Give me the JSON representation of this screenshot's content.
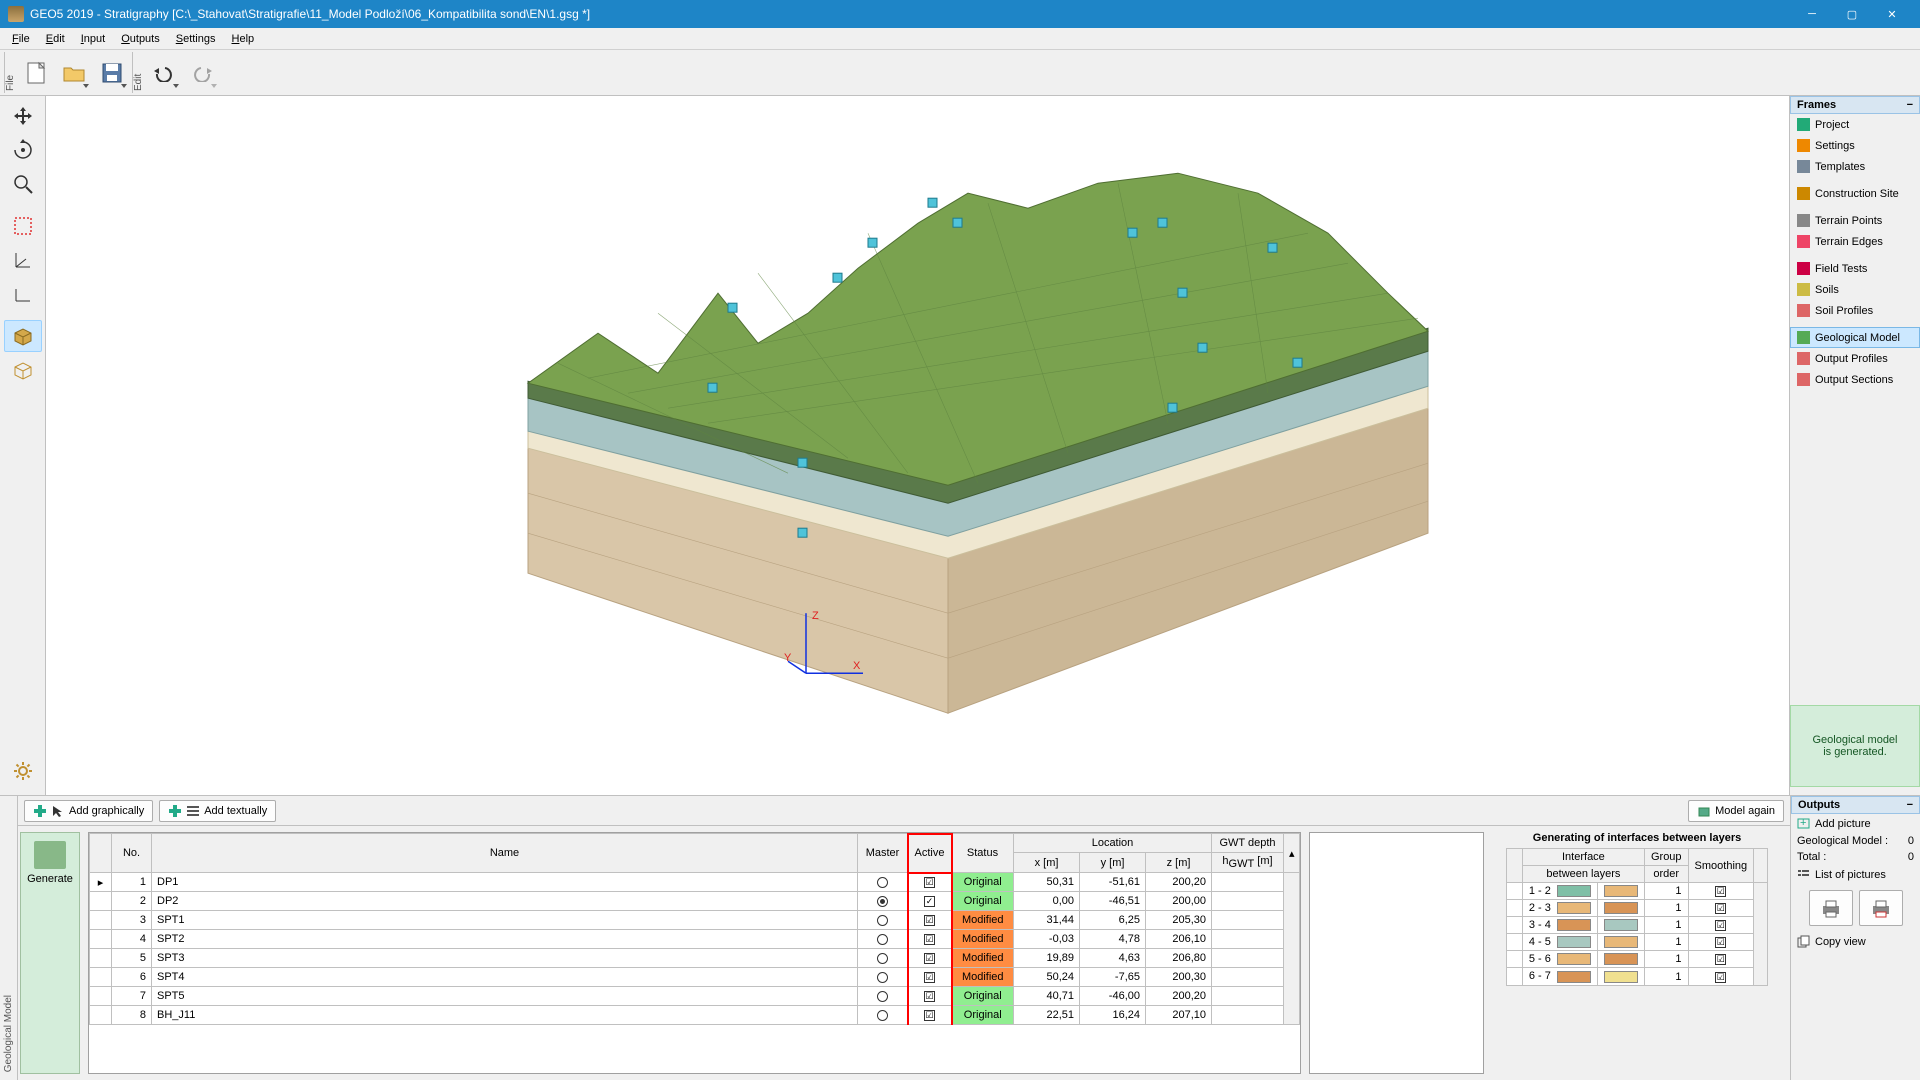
{
  "titlebar": {
    "app": "GEO5 2019 - Stratigraphy [C:\\_Stahovat\\Stratigrafie\\11_Model Podloží\\06_Kompatibilita sond\\EN\\1.gsg *]"
  },
  "menu": {
    "file": "File",
    "edit": "Edit",
    "input": "Input",
    "outputs": "Outputs",
    "settings": "Settings",
    "help": "Help"
  },
  "toolbar_labels": {
    "file": "File",
    "edit": "Edit"
  },
  "frames": {
    "title": "Frames",
    "items": [
      {
        "label": "Project",
        "icon": "#2a7"
      },
      {
        "label": "Settings",
        "icon": "#e80"
      },
      {
        "label": "Templates",
        "icon": "#789"
      },
      {
        "label": "Construction Site",
        "icon": "#c80"
      },
      {
        "label": "Terrain Points",
        "icon": "#888"
      },
      {
        "label": "Terrain Edges",
        "icon": "#e46"
      },
      {
        "label": "Field Tests",
        "icon": "#c04"
      },
      {
        "label": "Soils",
        "icon": "#cb4"
      },
      {
        "label": "Soil Profiles",
        "icon": "#d66"
      },
      {
        "label": "Geological Model",
        "icon": "#5a5",
        "selected": true
      },
      {
        "label": "Output Profiles",
        "icon": "#d66"
      },
      {
        "label": "Output Sections",
        "icon": "#d66"
      }
    ],
    "groups": [
      3,
      1,
      2,
      3,
      3
    ],
    "status": "Geological model\nis generated."
  },
  "bottom": {
    "label": "Geological Model",
    "add_graph": "Add graphically",
    "add_text": "Add textually",
    "model_again": "Model again",
    "generate": "Generate",
    "headers": {
      "no": "No.",
      "name": "Name",
      "master": "Master",
      "active": "Active",
      "status": "Status",
      "location": "Location",
      "x": "x [m]",
      "y": "y [m]",
      "z": "z [m]",
      "gwt": "GWT depth",
      "hgwt": "hGWT [m]"
    },
    "rows": [
      {
        "no": 1,
        "name": "DP1",
        "master": false,
        "active": true,
        "status": "Original",
        "x": "50,31",
        "y": "-51,61",
        "z": "200,20",
        "gwt": ""
      },
      {
        "no": 2,
        "name": "DP2",
        "master": true,
        "active": "tick",
        "status": "Original",
        "x": "0,00",
        "y": "-46,51",
        "z": "200,00",
        "gwt": ""
      },
      {
        "no": 3,
        "name": "SPT1",
        "master": false,
        "active": true,
        "status": "Modified",
        "x": "31,44",
        "y": "6,25",
        "z": "205,30",
        "gwt": ""
      },
      {
        "no": 4,
        "name": "SPT2",
        "master": false,
        "active": true,
        "status": "Modified",
        "x": "-0,03",
        "y": "4,78",
        "z": "206,10",
        "gwt": ""
      },
      {
        "no": 5,
        "name": "SPT3",
        "master": false,
        "active": true,
        "status": "Modified",
        "x": "19,89",
        "y": "4,63",
        "z": "206,80",
        "gwt": ""
      },
      {
        "no": 6,
        "name": "SPT4",
        "master": false,
        "active": true,
        "status": "Modified",
        "x": "50,24",
        "y": "-7,65",
        "z": "200,30",
        "gwt": ""
      },
      {
        "no": 7,
        "name": "SPT5",
        "master": false,
        "active": true,
        "status": "Original",
        "x": "40,71",
        "y": "-46,00",
        "z": "200,20",
        "gwt": ""
      },
      {
        "no": 8,
        "name": "BH_J11",
        "master": false,
        "active": true,
        "status": "Original",
        "x": "22,51",
        "y": "16,24",
        "z": "207,10",
        "gwt": ""
      }
    ],
    "iface_title": "Generating of interfaces between layers",
    "iface_headers": {
      "interface": "Interface",
      "between": "between layers",
      "group": "Group",
      "order": "order",
      "smoothing": "Smoothing"
    },
    "ifaces": [
      {
        "label": "1 - 2",
        "c1": "#7fbfa6",
        "c2": "#e8b878",
        "order": 1,
        "smooth": true
      },
      {
        "label": "2 - 3",
        "c1": "#e8b878",
        "c2": "#d89456",
        "order": 1,
        "smooth": true
      },
      {
        "label": "3 - 4",
        "c1": "#d89456",
        "c2": "#a8c8c0",
        "order": 1,
        "smooth": true
      },
      {
        "label": "4 - 5",
        "c1": "#a8c8c0",
        "c2": "#e8b878",
        "order": 1,
        "smooth": true
      },
      {
        "label": "5 - 6",
        "c1": "#e8b878",
        "c2": "#d89456",
        "order": 1,
        "smooth": true
      },
      {
        "label": "6 - 7",
        "c1": "#d89456",
        "c2": "#f0e090",
        "order": 1,
        "smooth": true
      }
    ]
  },
  "outputs": {
    "title": "Outputs",
    "add_picture": "Add picture",
    "geo_model": "Geological Model :",
    "geo_model_n": "0",
    "total": "Total :",
    "total_n": "0",
    "list": "List of pictures",
    "copy": "Copy view"
  }
}
